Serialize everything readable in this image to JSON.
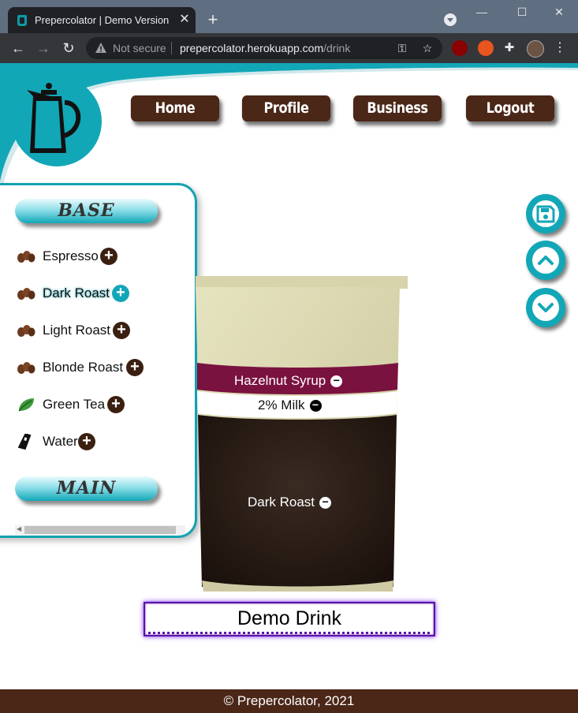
{
  "browser": {
    "tab_title": "Prepercolator | Demo Version",
    "security_label": "Not secure",
    "url_host": "prepercolator.herokuapp.com",
    "url_path": "/drink"
  },
  "nav": {
    "items": [
      "Home",
      "Profile",
      "Business",
      "Logout"
    ]
  },
  "sidebar": {
    "sections": [
      {
        "title": "BASE",
        "items": [
          {
            "label": "Espresso",
            "icon": "coffee-beans-icon"
          },
          {
            "label": "Dark Roast",
            "icon": "coffee-beans-icon",
            "active": true
          },
          {
            "label": "Light Roast",
            "icon": "coffee-beans-icon"
          },
          {
            "label": "Blonde Roast",
            "icon": "coffee-beans-icon"
          },
          {
            "label": "Green Tea",
            "icon": "tea-leaf-icon"
          },
          {
            "label": "Water",
            "icon": "water-bottle-icon"
          }
        ]
      },
      {
        "title": "MAIN",
        "items": []
      }
    ]
  },
  "drink": {
    "layers": [
      {
        "label": "Hazelnut Syrup",
        "color": "#7a1240"
      },
      {
        "label": "2% Milk",
        "color": "#ffffff"
      },
      {
        "label": "Dark Roast",
        "color": "#2a1a12"
      }
    ],
    "name": "Demo Drink"
  },
  "actions": {
    "icons": [
      "save-icon",
      "chevron-up-icon",
      "chevron-down-icon"
    ]
  },
  "footer": {
    "text": "© Prepercolator, 2021"
  },
  "colors": {
    "brand_brown": "#4b2718",
    "accent_teal": "#12a7b7",
    "name_border": "#5b13a8"
  }
}
